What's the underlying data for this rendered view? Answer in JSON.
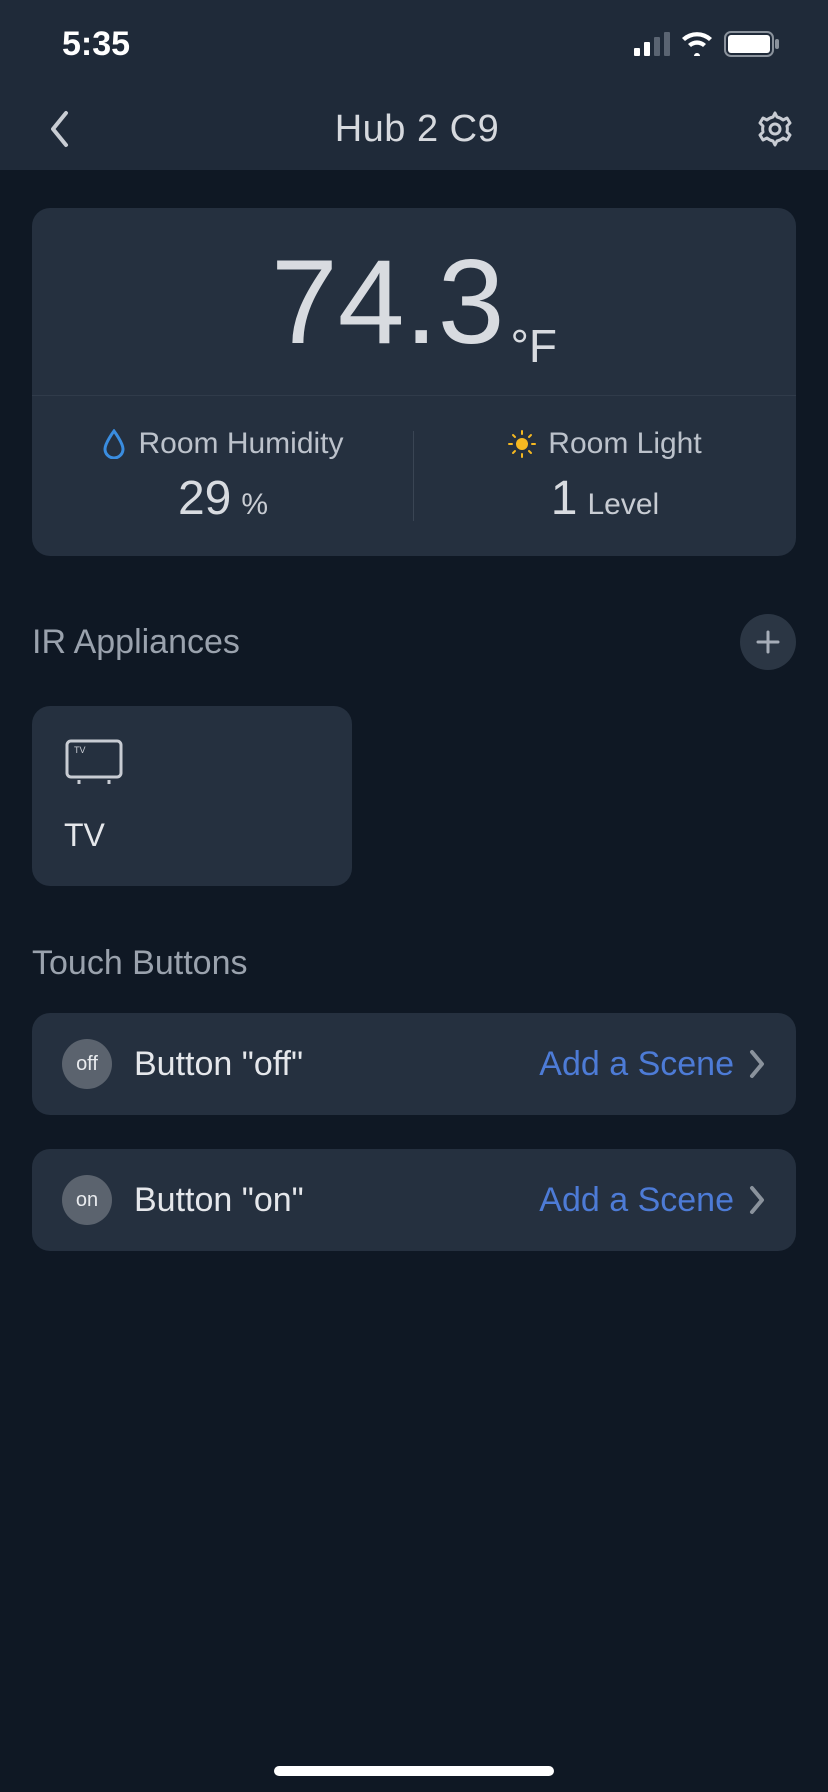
{
  "status": {
    "time": "5:35"
  },
  "header": {
    "title": "Hub 2 C9"
  },
  "temp_card": {
    "value": "74.3",
    "unit": "°F",
    "humidity": {
      "label": "Room Humidity",
      "value": "29",
      "suffix": "%"
    },
    "light": {
      "label": "Room Light",
      "value": "1",
      "suffix": "Level"
    }
  },
  "sections": {
    "ir_title": "IR Appliances",
    "touch_title": "Touch Buttons"
  },
  "appliances": [
    {
      "name": "TV"
    }
  ],
  "touch_buttons": [
    {
      "badge": "off",
      "label": "Button \"off\"",
      "action": "Add a Scene"
    },
    {
      "badge": "on",
      "label": "Button \"on\"",
      "action": "Add a Scene"
    }
  ]
}
